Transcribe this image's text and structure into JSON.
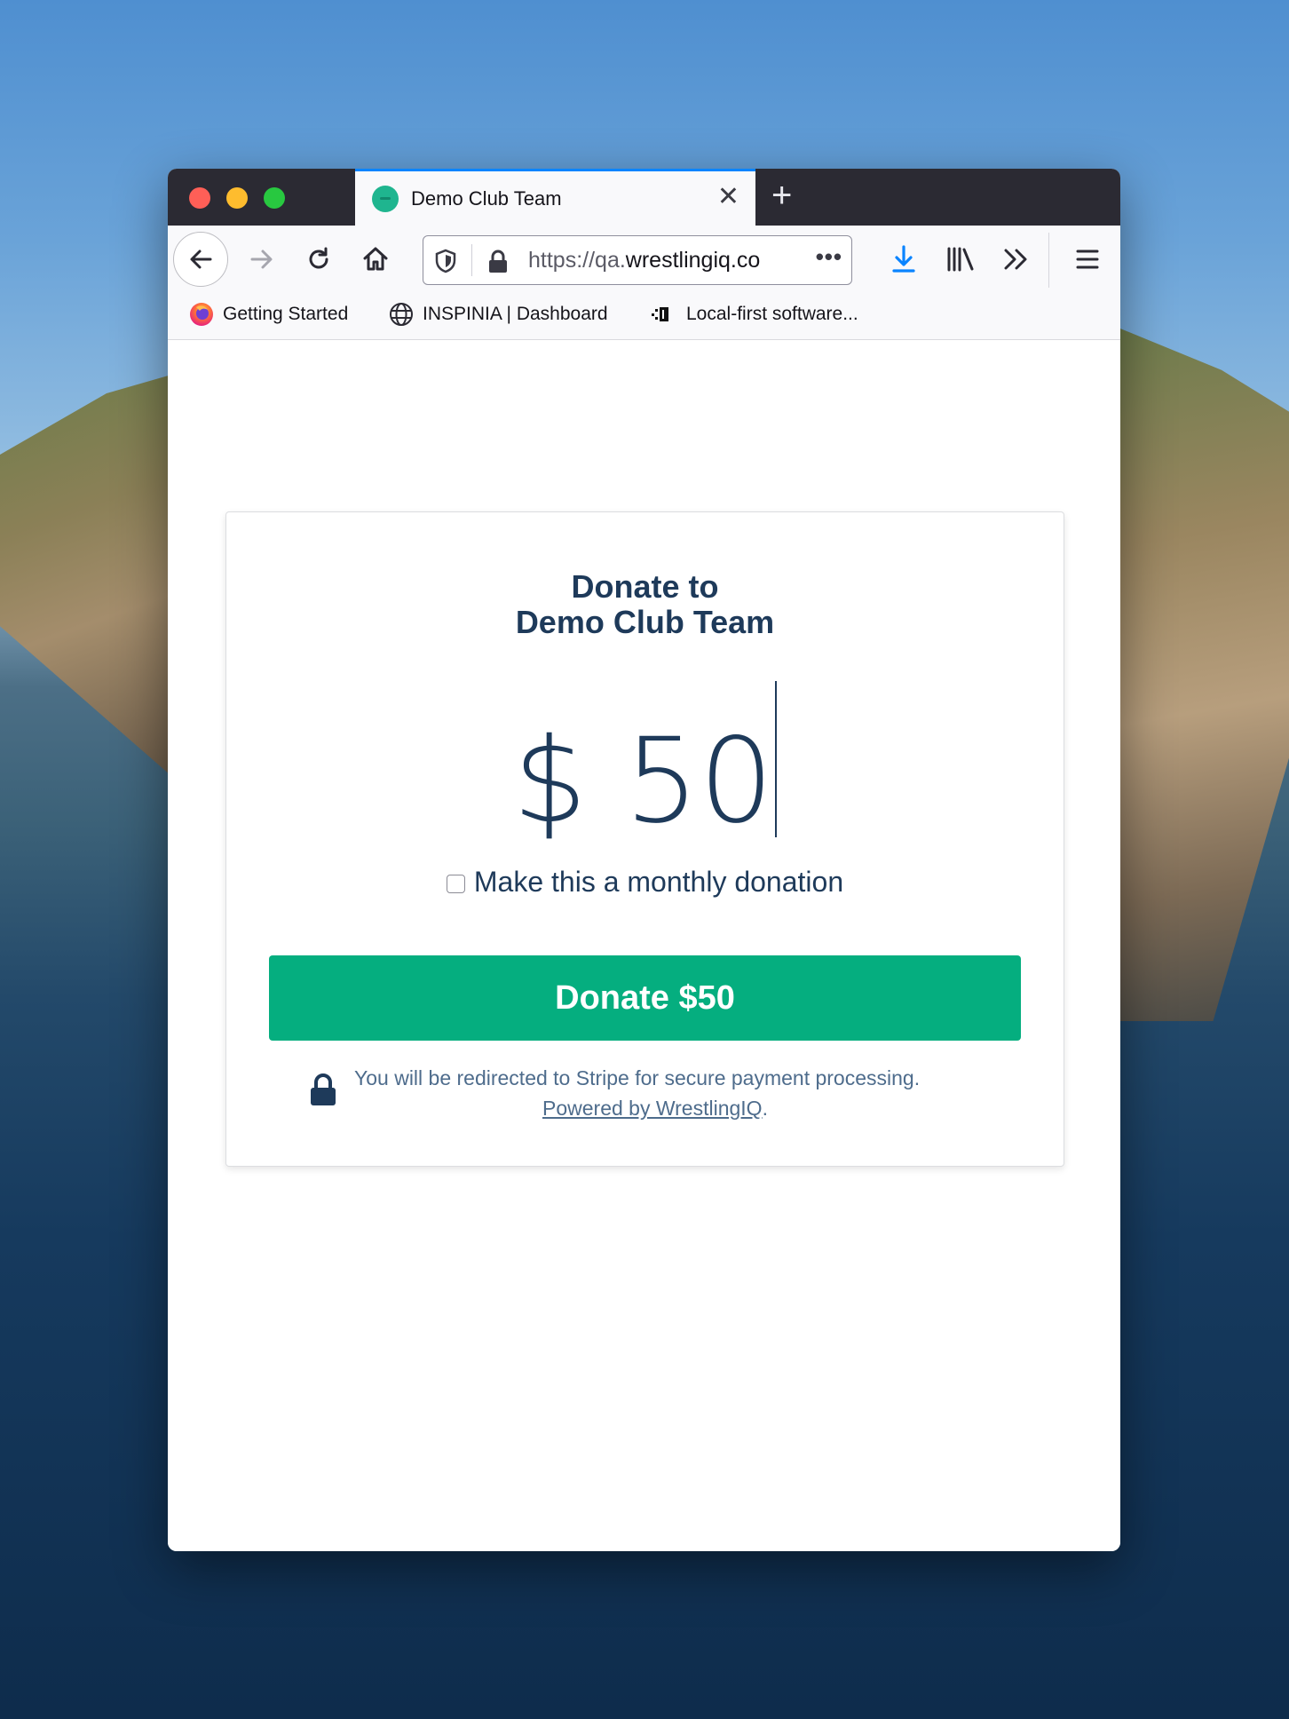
{
  "browser": {
    "tab_title": "Demo Club Team",
    "url_prefix": "https://qa.",
    "url_host": "wrestlingiq.co",
    "url_more": "•••",
    "bookmarks": [
      {
        "label": "Getting Started",
        "icon": "firefox-icon"
      },
      {
        "label": "INSPINIA | Dashboard",
        "icon": "globe-icon"
      },
      {
        "label": "Local-first software...",
        "icon": "site-icon"
      }
    ]
  },
  "donation": {
    "title_line1": "Donate to",
    "title_line2": "Demo Club Team",
    "amount_display": "$ 50",
    "monthly_label": "Make this a monthly donation",
    "monthly_checked": false,
    "button_label": "Donate $50",
    "note_text": "You will be redirected to Stripe for secure payment processing.",
    "powered_by_link": "Powered by WrestlingIQ",
    "powered_by_suffix": "."
  },
  "colors": {
    "brand_green": "#05ae7f",
    "text_navy": "#1e3a5a",
    "accent_blue": "#0a84ff"
  }
}
